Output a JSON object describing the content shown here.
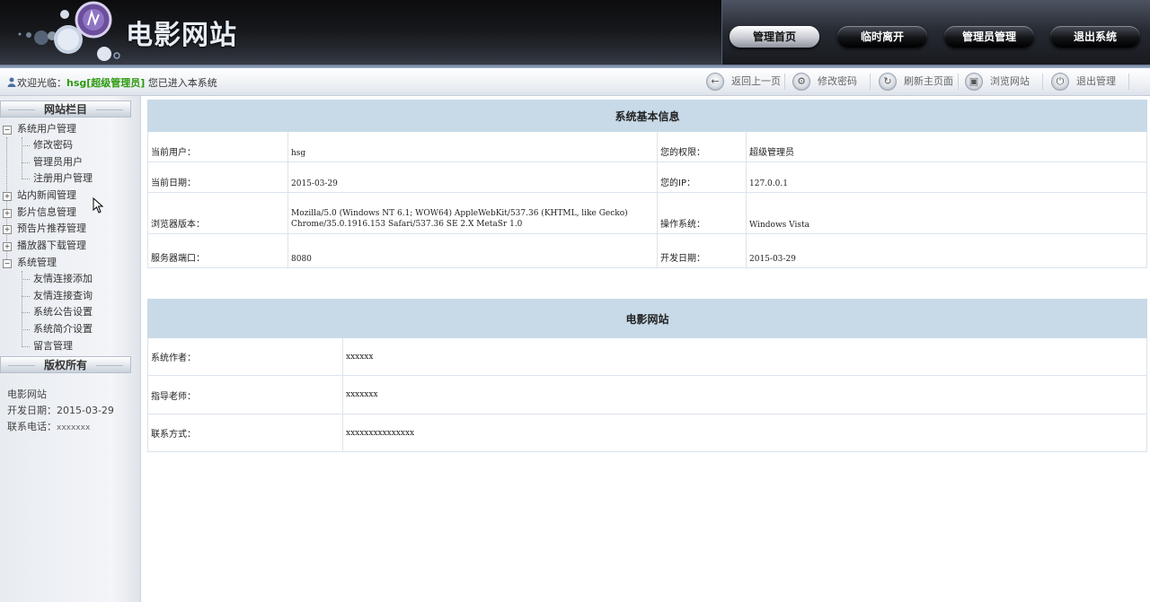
{
  "header": {
    "site_title": "电影网站",
    "nav": [
      "管理首页",
      "临时离开",
      "管理员管理",
      "退出系统"
    ],
    "active_nav": 0
  },
  "toolbar": {
    "welcome_prefix": "欢迎光临：",
    "user": "hsg[超级管理员]",
    "welcome_suffix": "您已进入本系统",
    "buttons": [
      {
        "label": "返回上一页",
        "icon": "back-arrow-icon"
      },
      {
        "label": "修改密码",
        "icon": "key-icon"
      },
      {
        "label": "刷新主页面",
        "icon": "refresh-icon"
      },
      {
        "label": "浏览网站",
        "icon": "browse-icon"
      },
      {
        "label": "退出管理",
        "icon": "power-icon"
      }
    ]
  },
  "sidebar": {
    "nav_heading": "网站栏目",
    "tree": [
      {
        "label": "系统用户管理",
        "expanded": true,
        "children": [
          "修改密码",
          "管理员用户",
          "注册用户管理"
        ]
      },
      {
        "label": "站内新闻管理",
        "expanded": false,
        "children": []
      },
      {
        "label": "影片信息管理",
        "expanded": false,
        "children": []
      },
      {
        "label": "预告片推荐管理",
        "expanded": false,
        "children": []
      },
      {
        "label": "播放器下载管理",
        "expanded": false,
        "children": []
      },
      {
        "label": "系统管理",
        "expanded": true,
        "children": [
          "友情连接添加",
          "友情连接查询",
          "系统公告设置",
          "系统简介设置",
          "留言管理"
        ]
      }
    ],
    "copyright_heading": "版权所有",
    "copyright": {
      "site": "电影网站",
      "dev_date": "开发日期：2015-03-29",
      "phone_label": "联系电话：",
      "phone_value": "xxxxxxx"
    }
  },
  "system_info": {
    "title": "系统基本信息",
    "rows": [
      [
        "当前用户：",
        "hsg",
        "您的权限：",
        "超级管理员"
      ],
      [
        "当前日期：",
        "2015-03-29",
        "您的IP：",
        "127.0.0.1"
      ],
      [
        "浏览器版本：",
        "Mozilla/5.0 (Windows NT 6.1; WOW64) AppleWebKit/537.36 (KHTML, like Gecko) Chrome/35.0.1916.153 Safari/537.36 SE 2.X MetaSr 1.0",
        "操作系统：",
        "Windows Vista"
      ],
      [
        "服务器端口：",
        "8080",
        "开发日期：",
        "2015-03-29"
      ]
    ]
  },
  "site_info": {
    "title": "电影网站",
    "rows": [
      [
        "系统作者：",
        "xxxxxx"
      ],
      [
        "指导老师：",
        "xxxxxxx"
      ],
      [
        "联系方式：",
        "xxxxxxxxxxxxxxx"
      ]
    ]
  }
}
